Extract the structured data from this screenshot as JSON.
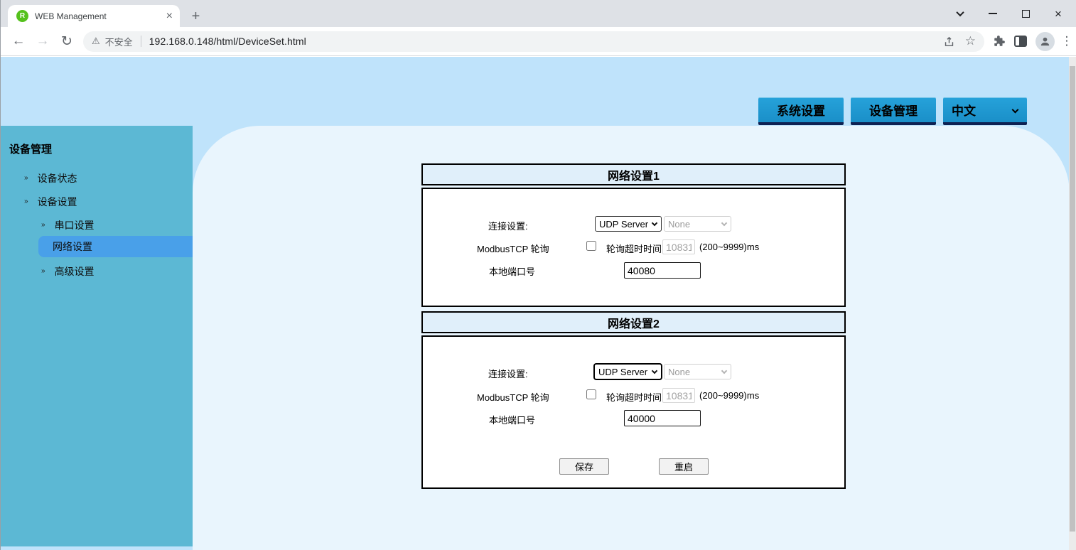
{
  "browser": {
    "tab_title": "WEB Management",
    "favicon_letter": "R",
    "security_label": "不安全",
    "url": "192.168.0.148/html/DeviceSet.html"
  },
  "topnav": {
    "system_settings_label": "系统设置",
    "device_management_label": "设备管理",
    "language_value": "中文"
  },
  "sidebar": {
    "title": "设备管理",
    "items": [
      {
        "label": "设备状态",
        "level": 1,
        "active": false
      },
      {
        "label": "设备设置",
        "level": 1,
        "active": false
      },
      {
        "label": "串口设置",
        "level": 2,
        "active": false
      },
      {
        "label": "网络设置",
        "level": 2,
        "active": true
      },
      {
        "label": "高级设置",
        "level": 2,
        "active": false
      }
    ]
  },
  "panels": [
    {
      "title": "网络设置1",
      "connection_label": "连接设置:",
      "connection_value": "UDP Server",
      "connection_secondary_value": "None",
      "modbus_label": "ModbusTCP 轮询",
      "modbus_checked": false,
      "timeout_label": "轮询超时时间",
      "timeout_value": "10831",
      "timeout_hint": "(200~9999)ms",
      "port_label": "本地端口号",
      "port_value": "40080"
    },
    {
      "title": "网络设置2",
      "connection_label": "连接设置:",
      "connection_value": "UDP Server",
      "connection_secondary_value": "None",
      "modbus_label": "ModbusTCP 轮询",
      "modbus_checked": false,
      "timeout_label": "轮询超时时间",
      "timeout_value": "10831",
      "timeout_hint": "(200~9999)ms",
      "port_label": "本地端口号",
      "port_value": "40000"
    }
  ],
  "actions": {
    "save_label": "保存",
    "restart_label": "重启"
  },
  "colors": {
    "page_bg": "#bfe3fb",
    "content_bg": "#e9f5fd",
    "sidebar_teal": "#5cb8d4",
    "active_item_blue": "#49a0e9",
    "button_blue": "#1b96d0",
    "panel_header_bg": "#e0effa",
    "favicon_green": "#55c11d"
  }
}
